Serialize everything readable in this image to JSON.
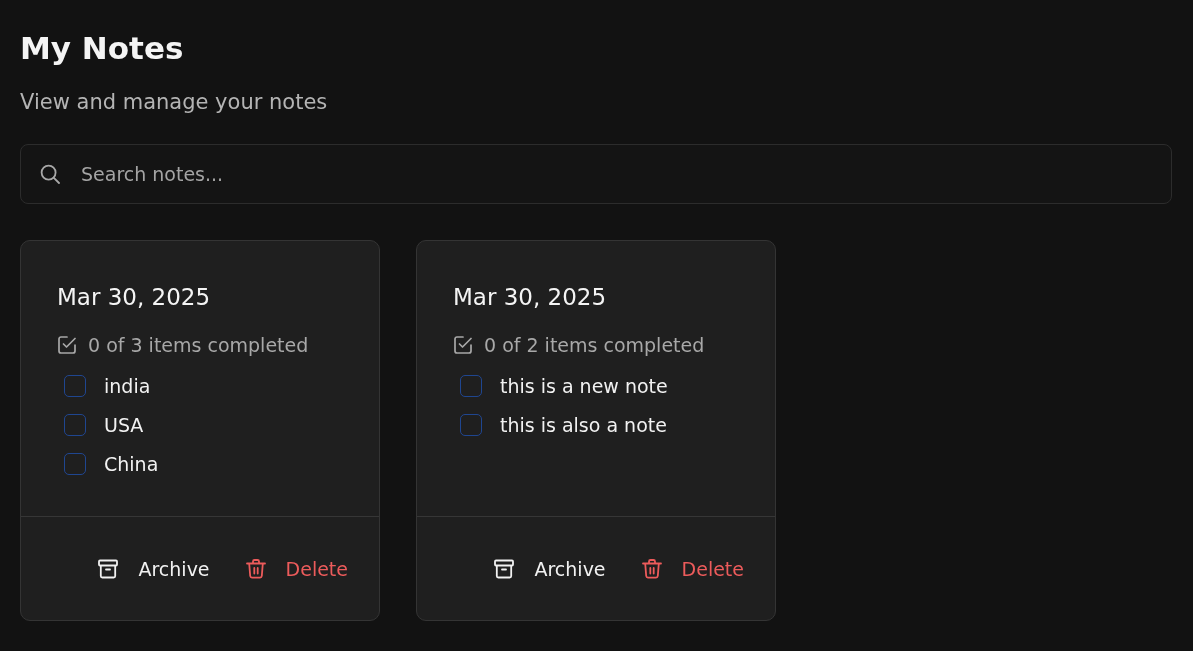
{
  "header": {
    "title": "My Notes",
    "subtitle": "View and manage your notes"
  },
  "search": {
    "placeholder": "Search notes..."
  },
  "notes": [
    {
      "date": "Mar 30, 2025",
      "summary": "0 of 3 items completed",
      "items": [
        {
          "text": "india",
          "checked": false
        },
        {
          "text": "USA",
          "checked": false
        },
        {
          "text": "China",
          "checked": false
        }
      ],
      "actions": [
        {
          "kind": "archive",
          "label": "Archive"
        },
        {
          "kind": "delete",
          "label": "Delete"
        }
      ]
    },
    {
      "date": "Mar 30, 2025",
      "summary": "0 of 2 items completed",
      "items": [
        {
          "text": "this is a new note",
          "checked": false
        },
        {
          "text": "this is also a note",
          "checked": false
        }
      ],
      "actions": [
        {
          "kind": "archive",
          "label": "Archive"
        },
        {
          "kind": "delete",
          "label": "Delete"
        }
      ]
    }
  ]
}
